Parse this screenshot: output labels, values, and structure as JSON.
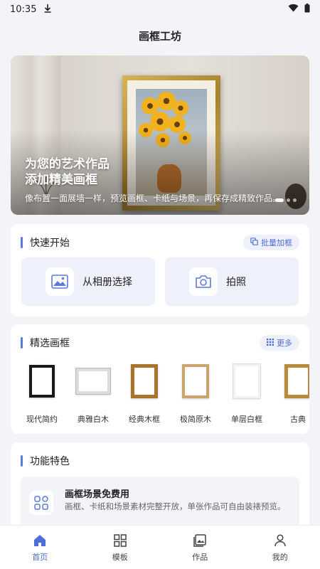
{
  "status": {
    "time": "10:35"
  },
  "header": {
    "title": "画框工坊"
  },
  "banner": {
    "title_line1": "为您的艺术作品",
    "title_line2": "添加精美画框",
    "subtitle": "像布置一面展墙一样，预览画框、卡纸与场景，再保存成精致作品。"
  },
  "quick_start": {
    "title": "快速开始",
    "batch_label": "批量加框",
    "album_label": "从相册选择",
    "camera_label": "拍照"
  },
  "featured": {
    "title": "精选画框",
    "more_label": "更多",
    "items": [
      {
        "label": "现代简约",
        "color": "#1a1a1a"
      },
      {
        "label": "典雅白木",
        "color": "#e9e9e9"
      },
      {
        "label": "经典木框",
        "color": "#a8732f"
      },
      {
        "label": "极简原木",
        "color": "#c9a470"
      },
      {
        "label": "单层白框",
        "color": "#f4f4f4"
      },
      {
        "label": "古典",
        "color": "#b98a3e"
      }
    ]
  },
  "features": {
    "title": "功能特色",
    "item_title": "画框场景免费用",
    "item_desc": "画框、卡纸和场景素材完整开放，单张作品可自由装裱预览。"
  },
  "tabbar": {
    "tabs": [
      {
        "label": "首页",
        "icon": "home-icon",
        "active": true
      },
      {
        "label": "模板",
        "icon": "grid-icon",
        "active": false
      },
      {
        "label": "作品",
        "icon": "gallery-icon",
        "active": false
      },
      {
        "label": "我的",
        "icon": "person-icon",
        "active": false
      }
    ]
  },
  "colors": {
    "accent": "#4e6fd8",
    "accent_bg": "#eef1fb",
    "page_bg": "#f3f4f8"
  }
}
